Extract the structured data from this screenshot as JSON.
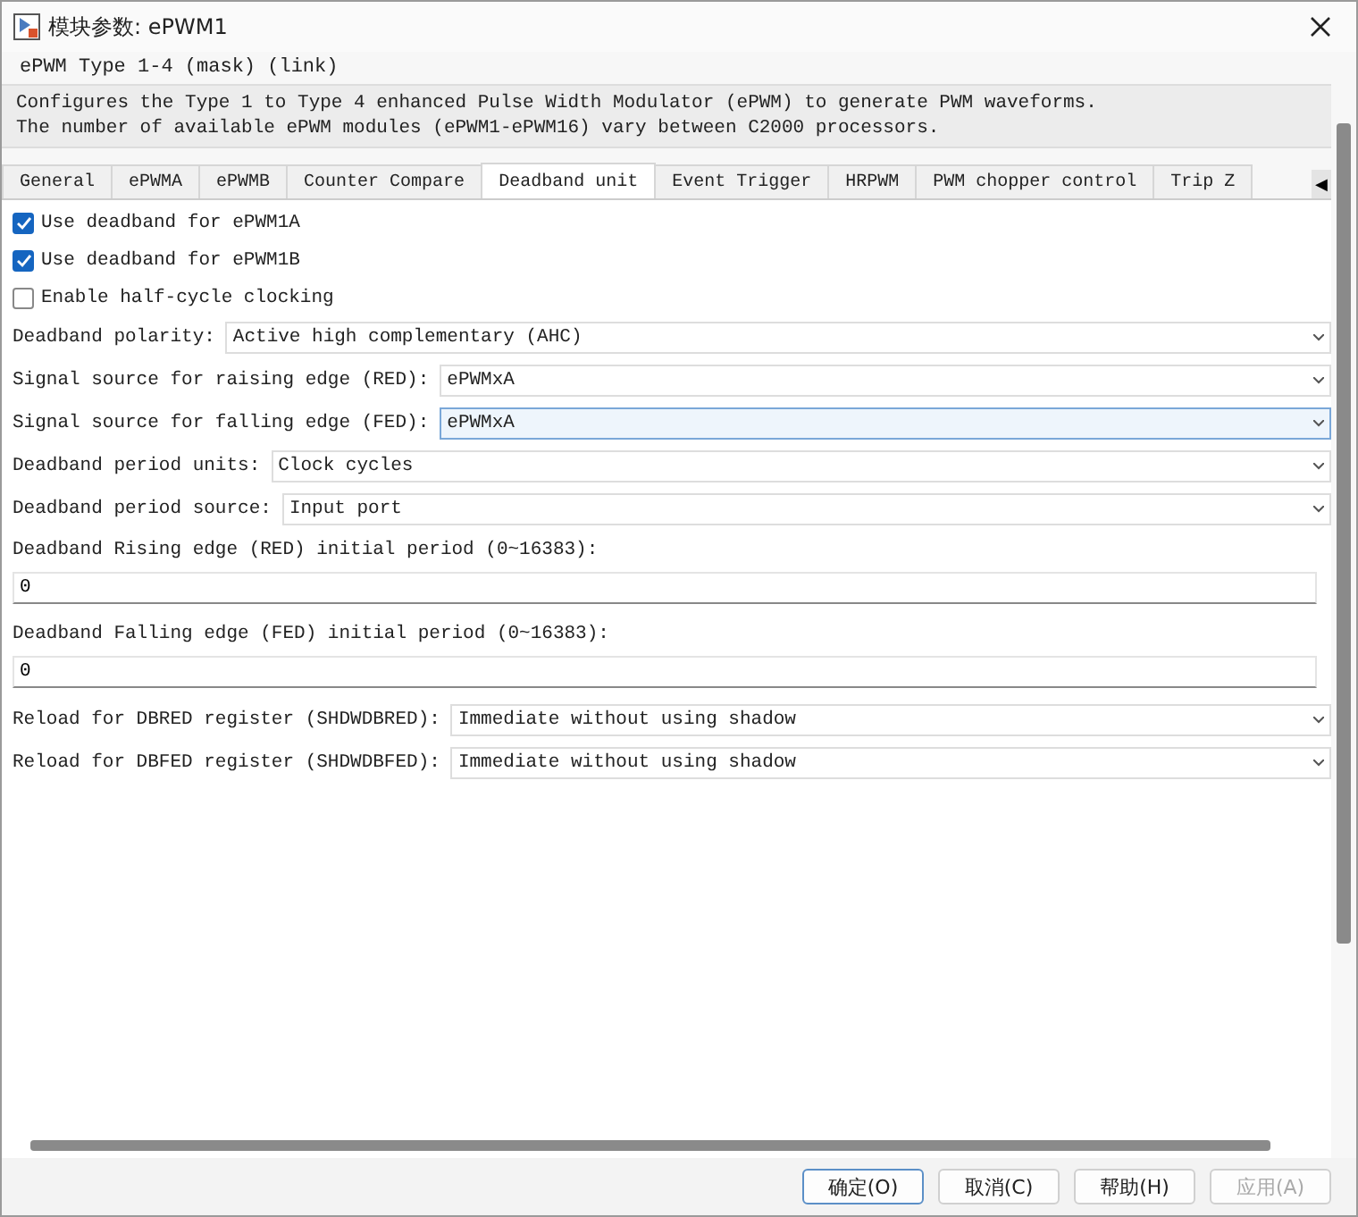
{
  "window": {
    "title": "模块参数: ePWM1"
  },
  "group_title": "ePWM Type 1-4 (mask) (link)",
  "description": [
    "Configures the Type 1 to Type 4 enhanced Pulse Width Modulator (ePWM) to generate PWM waveforms.",
    "The number of available ePWM modules (ePWM1-ePWM16) vary between C2000 processors."
  ],
  "tabs": [
    {
      "label": "General",
      "selected": false
    },
    {
      "label": "ePWMA",
      "selected": false
    },
    {
      "label": "ePWMB",
      "selected": false
    },
    {
      "label": "Counter Compare",
      "selected": false
    },
    {
      "label": "Deadband unit",
      "selected": true
    },
    {
      "label": "Event Trigger",
      "selected": false
    },
    {
      "label": "HRPWM",
      "selected": false
    },
    {
      "label": "PWM chopper control",
      "selected": false
    },
    {
      "label": "Trip Z",
      "selected": false
    }
  ],
  "tab_scroll": "◀",
  "params": [
    {
      "kind": "checkbox",
      "label": "Use deadband for ePWM1A",
      "checked": true
    },
    {
      "kind": "checkbox",
      "label": "Use deadband for ePWM1B",
      "checked": true
    },
    {
      "kind": "checkbox",
      "label": "Enable half-cycle clocking",
      "checked": false
    },
    {
      "kind": "dropdown",
      "label": "Deadband polarity:",
      "value": "Active high complementary (AHC)",
      "focused": false
    },
    {
      "kind": "dropdown",
      "label": "Signal source for raising edge (RED):",
      "value": "ePWMxA",
      "focused": false
    },
    {
      "kind": "dropdown",
      "label": "Signal source for falling edge (FED):",
      "value": "ePWMxA",
      "focused": true
    },
    {
      "kind": "dropdown",
      "label": "Deadband period units:",
      "value": "Clock cycles",
      "focused": false
    },
    {
      "kind": "dropdown",
      "label": "Deadband period source:",
      "value": "Input port",
      "focused": false
    },
    {
      "kind": "textfield",
      "label": "Deadband Rising edge (RED) initial period (0~16383):",
      "value": "0"
    },
    {
      "kind": "textfield",
      "label": "Deadband Falling edge (FED) initial period (0~16383):",
      "value": "0"
    },
    {
      "kind": "dropdown",
      "label": "Reload for DBRED register (SHDWDBRED):",
      "value": "Immediate without using shadow",
      "focused": false
    },
    {
      "kind": "dropdown",
      "label": "Reload for DBFED register (SHDWDBFED):",
      "value": "Immediate without using shadow",
      "focused": false
    }
  ],
  "buttons": [
    {
      "label": "确定(O)",
      "disabled": false,
      "default": true
    },
    {
      "label": "取消(C)",
      "disabled": false,
      "default": false
    },
    {
      "label": "帮助(H)",
      "disabled": false,
      "default": false
    },
    {
      "label": "应用(A)",
      "disabled": true,
      "default": false
    }
  ]
}
